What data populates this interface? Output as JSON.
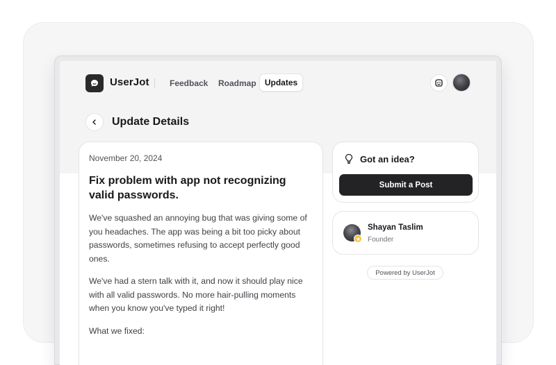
{
  "header": {
    "brand": "UserJot",
    "nav": [
      {
        "label": "Feedback",
        "active": false
      },
      {
        "label": "Roadmap",
        "active": false
      },
      {
        "label": "Updates",
        "active": true
      }
    ],
    "icons": [
      "userjot-logo-icon",
      "smiley-icon",
      "user-avatar"
    ]
  },
  "page": {
    "title": "Update Details",
    "back_icon": "chevron-left-icon"
  },
  "post": {
    "date": "November 20, 2024",
    "title": "Fix problem with app not recognizing valid passwords.",
    "paragraphs": [
      "We've squashed an annoying bug that was giving some of you headaches. The app was being a bit too picky about passwords, sometimes refusing to accept perfectly good ones.",
      "We've had a stern talk with it, and now it should play nice with all valid passwords. No more hair-pulling moments when you know you've typed it right!",
      "What we fixed:"
    ]
  },
  "sidebar": {
    "idea": {
      "icon": "lightbulb-icon",
      "title": "Got an idea?",
      "button_label": "Submit a Post"
    },
    "author": {
      "name": "Shayan Taslim",
      "role": "Founder",
      "badge_icon": "star-icon"
    },
    "powered_by": "Powered by UserJot"
  },
  "colors": {
    "accent_dark": "#232326",
    "background": "#f4f4f5",
    "badge": "#f5c542"
  }
}
